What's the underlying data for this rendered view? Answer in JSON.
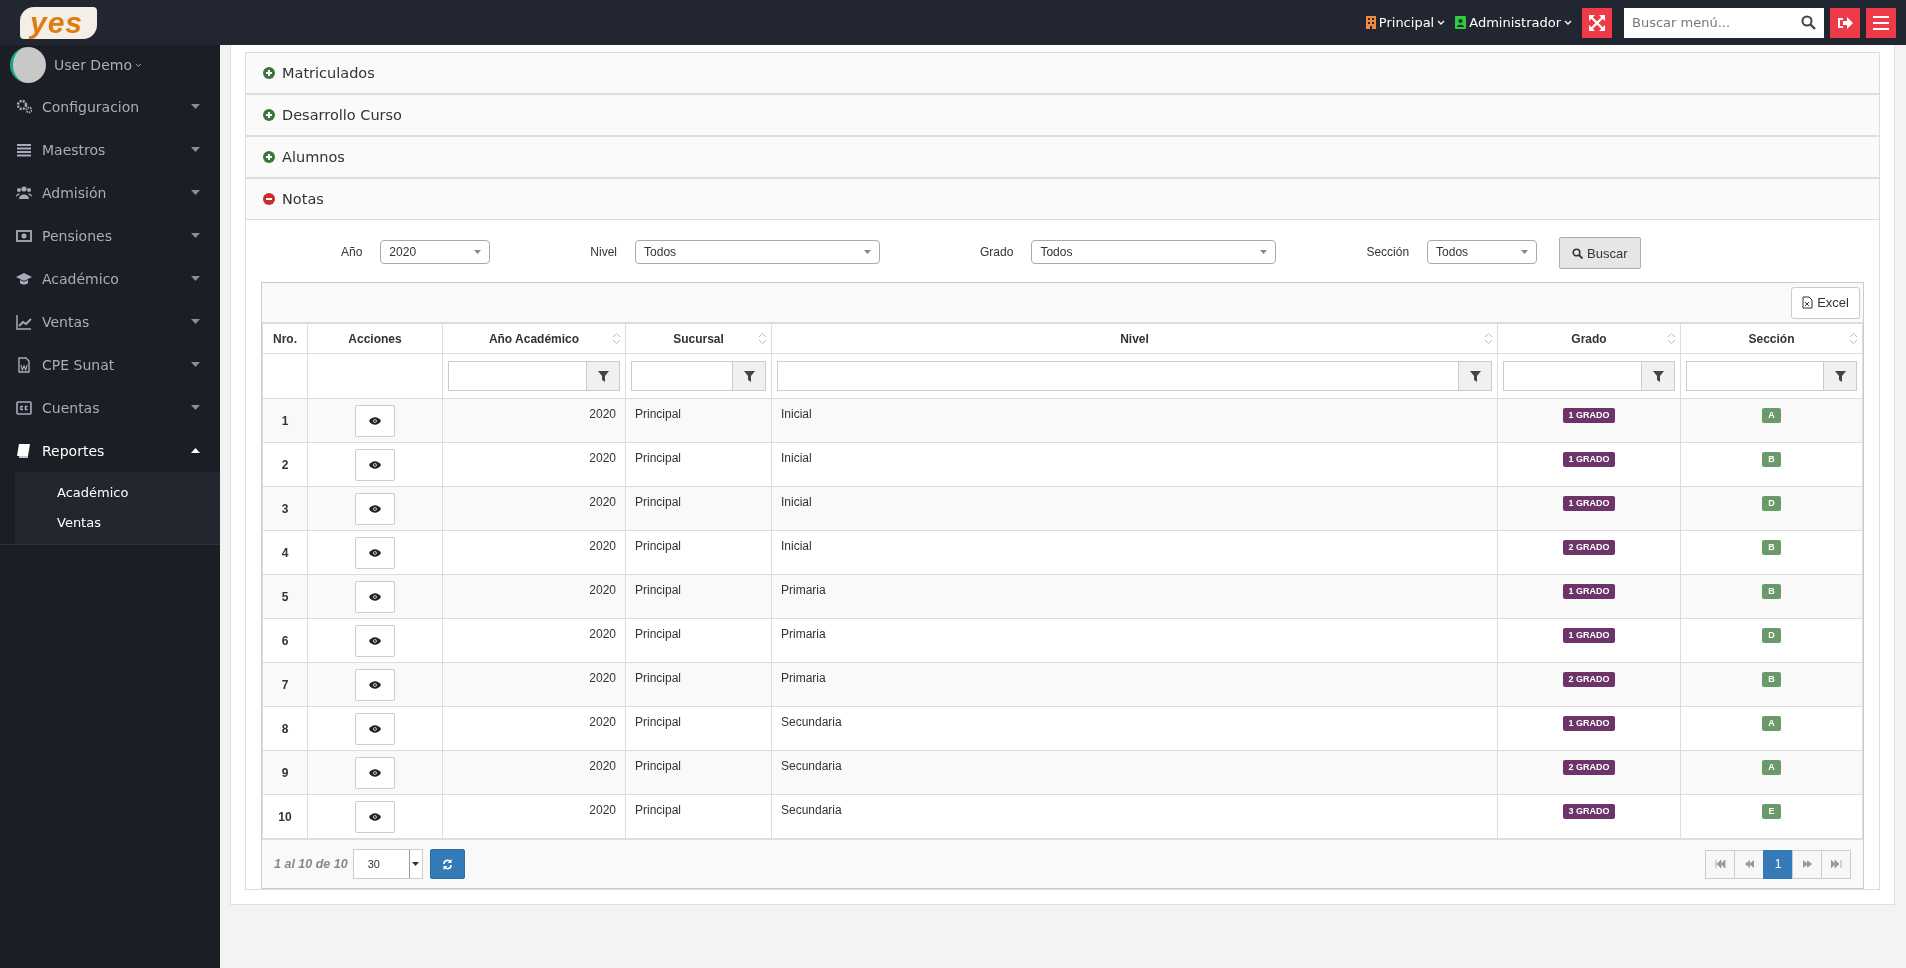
{
  "topbar": {
    "logo": "yes",
    "branch": "Principal",
    "role": "Administrador",
    "search": {
      "placeholder": "Buscar menú..."
    }
  },
  "sidebar": {
    "user": "User Demo",
    "items": [
      {
        "label": "Configuracion",
        "expanded": false
      },
      {
        "label": "Maestros",
        "expanded": false
      },
      {
        "label": "Admisión",
        "expanded": false
      },
      {
        "label": "Pensiones",
        "expanded": false
      },
      {
        "label": "Académico",
        "expanded": false
      },
      {
        "label": "Ventas",
        "expanded": false
      },
      {
        "label": "CPE Sunat",
        "expanded": false
      },
      {
        "label": "Cuentas",
        "expanded": false
      },
      {
        "label": "Reportes",
        "expanded": true,
        "children": [
          {
            "label": "Académico"
          },
          {
            "label": "Ventas"
          }
        ]
      }
    ]
  },
  "sections": [
    {
      "title": "Matriculados",
      "expanded": false
    },
    {
      "title": "Desarrollo Curso",
      "expanded": false
    },
    {
      "title": "Alumnos",
      "expanded": false
    },
    {
      "title": "Notas",
      "expanded": true
    }
  ],
  "filters": [
    {
      "label": "Año",
      "value": "2020"
    },
    {
      "label": "Nivel",
      "value": "Todos"
    },
    {
      "label": "Grado",
      "value": "Todos"
    },
    {
      "label": "Sección",
      "value": "Todos"
    }
  ],
  "search_button": "Buscar",
  "table": {
    "export_button": "Excel",
    "columns": [
      "Nro.",
      "Acciones",
      "Año Académico",
      "Sucursal",
      "Nivel",
      "Grado",
      "Sección"
    ],
    "rows": [
      {
        "nro": "1",
        "year": "2020",
        "branch": "Principal",
        "level": "Inicial",
        "grade": "1 GRADO",
        "section": "A"
      },
      {
        "nro": "2",
        "year": "2020",
        "branch": "Principal",
        "level": "Inicial",
        "grade": "1 GRADO",
        "section": "B"
      },
      {
        "nro": "3",
        "year": "2020",
        "branch": "Principal",
        "level": "Inicial",
        "grade": "1 GRADO",
        "section": "D"
      },
      {
        "nro": "4",
        "year": "2020",
        "branch": "Principal",
        "level": "Inicial",
        "grade": "2 GRADO",
        "section": "B"
      },
      {
        "nro": "5",
        "year": "2020",
        "branch": "Principal",
        "level": "Primaria",
        "grade": "1 GRADO",
        "section": "B"
      },
      {
        "nro": "6",
        "year": "2020",
        "branch": "Principal",
        "level": "Primaria",
        "grade": "1 GRADO",
        "section": "D"
      },
      {
        "nro": "7",
        "year": "2020",
        "branch": "Principal",
        "level": "Primaria",
        "grade": "2 GRADO",
        "section": "B"
      },
      {
        "nro": "8",
        "year": "2020",
        "branch": "Principal",
        "level": "Secundaria",
        "grade": "1 GRADO",
        "section": "A"
      },
      {
        "nro": "9",
        "year": "2020",
        "branch": "Principal",
        "level": "Secundaria",
        "grade": "2 GRADO",
        "section": "A"
      },
      {
        "nro": "10",
        "year": "2020",
        "branch": "Principal",
        "level": "Secundaria",
        "grade": "3 GRADO",
        "section": "E"
      }
    ],
    "record_info": "1 al 10 de 10",
    "page_size": "30",
    "pages": [
      {
        "label": "1",
        "selected": true
      }
    ]
  }
}
